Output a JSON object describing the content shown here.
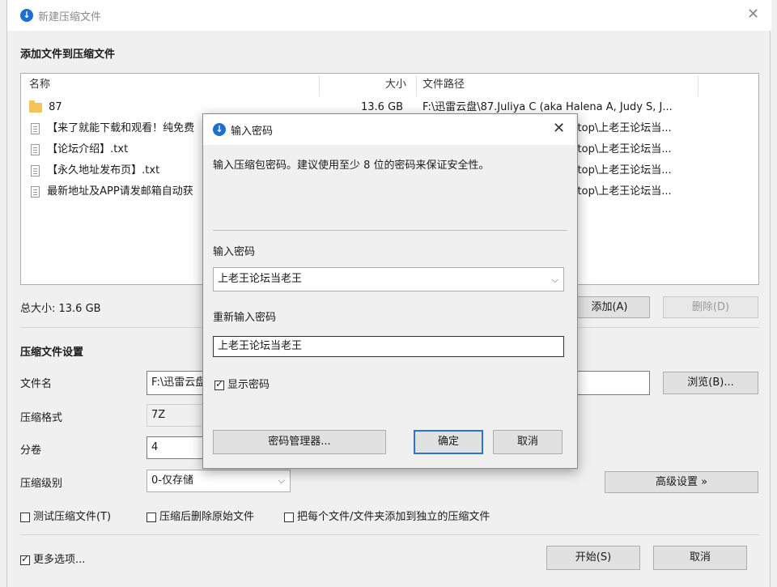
{
  "window": {
    "title": "新建压缩文件",
    "section_add": "添加文件到压缩文件"
  },
  "file_list": {
    "headers": {
      "name": "名称",
      "size": "大小",
      "path": "文件路径"
    },
    "rows": [
      {
        "name": "87",
        "size": "13.6 GB",
        "path": "F:\\迅雷云盘\\87.Juliya C (aka Halena A, Judy S, J..."
      },
      {
        "name": "【来了就能下载和观看！纯免费",
        "size": "",
        "path": "ktop\\上老王论坛当..."
      },
      {
        "name": "【论坛介绍】.txt",
        "size": "",
        "path": "ktop\\上老王论坛当..."
      },
      {
        "name": "【永久地址发布页】.txt",
        "size": "",
        "path": "ktop\\上老王论坛当..."
      },
      {
        "name": "最新地址及APP请发邮箱自动获",
        "size": "",
        "path": "ktop\\上老王论坛当..."
      }
    ]
  },
  "total": "总大小: 13.6 GB",
  "buttons": {
    "add": "添加(A)",
    "delete": "删除(D)",
    "browse": "浏览(B)...",
    "advanced": "高级设置 »",
    "start": "开始(S)",
    "cancel": "取消"
  },
  "settings": {
    "title": "压缩文件设置",
    "filename_label": "文件名",
    "filename_value": "F:\\迅雷云盘",
    "format_label": "压缩格式",
    "format_value": "7Z",
    "split_label": "分卷",
    "split_value": "4",
    "level_label": "压缩级别",
    "level_value": "0-仅存储"
  },
  "options": {
    "test": "测试压缩文件(T)",
    "delete_after": "压缩后删除原始文件",
    "separate": "把每个文件/文件夹添加到独立的压缩文件",
    "more": "更多选项..."
  },
  "dialog": {
    "title": "输入密码",
    "hint": "输入压缩包密码。建议使用至少 8 位的密码来保证安全性。",
    "pw_label": "输入密码",
    "pw_value": "上老王论坛当老王",
    "pw2_label": "重新输入密码",
    "pw2_value": "上老王论坛当老王",
    "show_pw": "显示密码",
    "manager": "密码管理器...",
    "ok": "确定",
    "cancel": "取消"
  }
}
